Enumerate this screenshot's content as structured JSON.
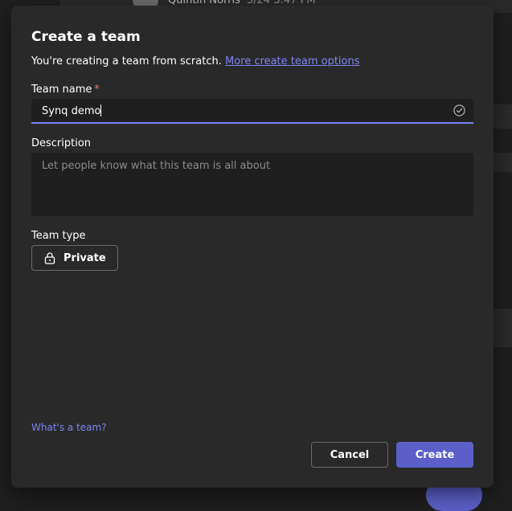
{
  "background": {
    "user_name": "Quintin Norris",
    "time": "5/24 3:47 PM"
  },
  "dialog": {
    "title": "Create a team",
    "subtitle_text": "You're creating a team from scratch.",
    "subtitle_link": "More create team options",
    "team_name": {
      "label": "Team name",
      "required_marker": "*",
      "value": "Synq demo"
    },
    "description": {
      "label": "Description",
      "placeholder": "Let people know what this team is all about"
    },
    "team_type": {
      "label": "Team type",
      "value": "Private",
      "icon": "lock-icon"
    },
    "help_link": "What's a team?",
    "cancel_label": "Cancel",
    "create_label": "Create"
  },
  "colors": {
    "accent": "#5b5fc7",
    "link": "#7f85f5",
    "required": "#e37d80",
    "dialog_bg": "#292929",
    "field_bg": "#1f1f1f"
  }
}
